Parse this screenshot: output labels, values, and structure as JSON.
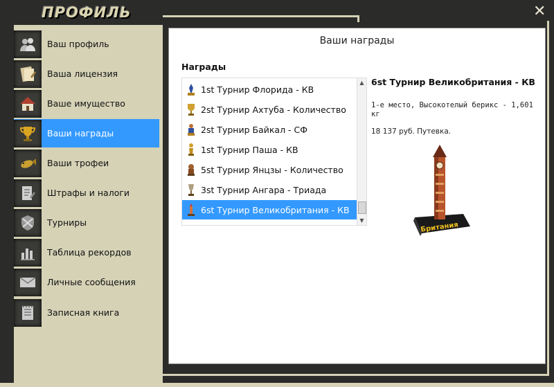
{
  "window": {
    "title": "ПРОФИЛЬ",
    "close_label": "✕"
  },
  "sidebar": {
    "items": [
      {
        "label": "Ваш профиль",
        "icon": "users-icon"
      },
      {
        "label": "Ваша лицензия",
        "icon": "license-icon"
      },
      {
        "label": "Ваше имущество",
        "icon": "house-icon"
      },
      {
        "label": "Ваши награды",
        "icon": "trophy-icon",
        "active": true
      },
      {
        "label": "Ваши трофеи",
        "icon": "fish-icon"
      },
      {
        "label": "Штрафы и налоги",
        "icon": "fines-icon"
      },
      {
        "label": "Турниры",
        "icon": "tournament-icon"
      },
      {
        "label": "Таблица рекордов",
        "icon": "chart-icon"
      },
      {
        "label": "Личные сообщения",
        "icon": "envelope-icon"
      },
      {
        "label": "Записная книга",
        "icon": "notebook-icon"
      }
    ]
  },
  "panel": {
    "title": "Ваши награды",
    "awards_header": "Награды",
    "awards": [
      {
        "label": "1st Турнир Флорида - КВ"
      },
      {
        "label": "2st Турнир Ахтуба - Количество"
      },
      {
        "label": "2st Турнир Байкал - СФ"
      },
      {
        "label": "1st Турнир Паша - КВ"
      },
      {
        "label": "5st Турнир Янцзы - Количество"
      },
      {
        "label": "3st Турнир Ангара - Триада"
      },
      {
        "label": "6st Турнир Великобритания - КВ",
        "selected": true
      }
    ],
    "detail": {
      "title": "6st Турнир Великобритания - КВ",
      "description": "1-е место, Высокотелый берикс - 1,601 кг",
      "prize": "18 137 руб. Путевка.",
      "badge": "Британия"
    }
  },
  "colors": {
    "accent": "#3399ff",
    "sidebar_bg": "#d5d2b6",
    "frame": "#2b2b29"
  }
}
